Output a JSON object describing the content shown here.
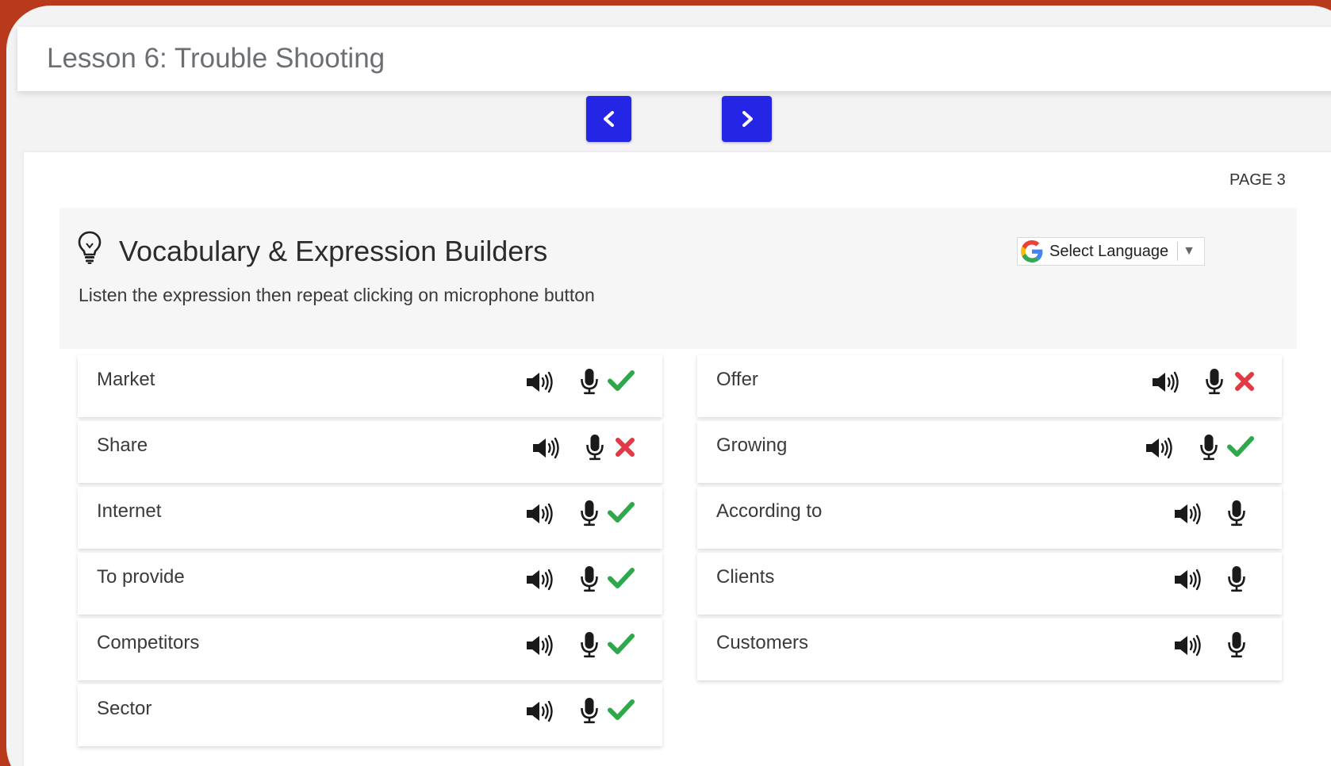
{
  "lesson": {
    "title": "Lesson 6: Trouble Shooting"
  },
  "nav": {
    "prev_icon": "chevron-left-icon",
    "next_icon": "chevron-right-icon",
    "color": "#2525e6"
  },
  "page": {
    "label": "PAGE 3"
  },
  "section": {
    "title": "Vocabulary & Expression Builders",
    "instructions": "Listen the expression then repeat clicking on microphone button",
    "icon": "lightbulb-icon"
  },
  "translate": {
    "label": "Select Language",
    "arrow": "▼",
    "icon": "google-icon"
  },
  "colors": {
    "frame": "#b8391c",
    "check": "#2ea84a",
    "cross": "#e03a45",
    "nav": "#2525e6"
  },
  "vocab": {
    "left": [
      {
        "word": "Market",
        "status": "correct"
      },
      {
        "word": "Share",
        "status": "incorrect"
      },
      {
        "word": "Internet",
        "status": "correct"
      },
      {
        "word": "To provide",
        "status": "correct"
      },
      {
        "word": "Competitors",
        "status": "correct"
      },
      {
        "word": "Sector",
        "status": "correct"
      }
    ],
    "right": [
      {
        "word": "Offer",
        "status": "incorrect"
      },
      {
        "word": "Growing",
        "status": "correct"
      },
      {
        "word": "According to",
        "status": "none"
      },
      {
        "word": "Clients",
        "status": "none"
      },
      {
        "word": "Customers",
        "status": "none"
      }
    ]
  }
}
